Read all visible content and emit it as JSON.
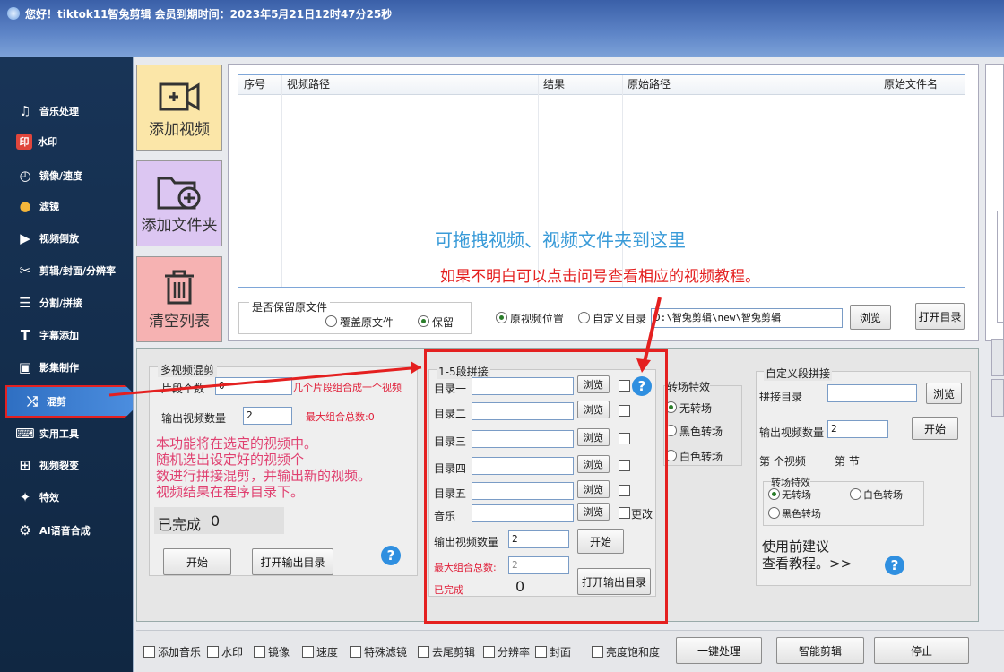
{
  "title": "您好！tiktok11智兔剪辑  会员到期时间：2023年5月21日12时47分25秒",
  "sidebar": {
    "items": [
      {
        "label": "音乐处理",
        "icon": "music-note-icon",
        "glyph": "♫"
      },
      {
        "label": "水印",
        "icon": "watermark-icon",
        "glyph": "印"
      },
      {
        "label": "镜像/速度",
        "icon": "speed-gauge-icon",
        "glyph": "◴"
      },
      {
        "label": "滤镜",
        "icon": "filter-icon",
        "glyph": "●"
      },
      {
        "label": "视频倒放",
        "icon": "video-reverse-icon",
        "glyph": "▶"
      },
      {
        "label": "剪辑/封面/分辨率",
        "icon": "scissors-icon",
        "glyph": "✂"
      },
      {
        "label": "分割/拼接",
        "icon": "split-join-icon",
        "glyph": "☰"
      },
      {
        "label": "字幕添加",
        "icon": "subtitle-icon",
        "glyph": "T"
      },
      {
        "label": "影集制作",
        "icon": "album-icon",
        "glyph": "▣"
      },
      {
        "label": "混剪",
        "icon": "shuffle-icon",
        "glyph": "⤮"
      },
      {
        "label": "实用工具",
        "icon": "tools-icon",
        "glyph": "⌨"
      },
      {
        "label": "视频裂变",
        "icon": "video-split-icon",
        "glyph": "⊞"
      },
      {
        "label": "特效",
        "icon": "sparkle-icon",
        "glyph": "✦"
      },
      {
        "label": "AI语音合成",
        "icon": "ai-voice-icon",
        "glyph": "⚙"
      }
    ]
  },
  "actions": {
    "add_video": "添加视频",
    "add_folder": "添加文件夹",
    "clear_list": "清空列表"
  },
  "table": {
    "columns": [
      "序号",
      "视频路径",
      "结果",
      "原始路径",
      "原始文件名"
    ],
    "drop_hint": "可拖拽视频、视频文件夹到这里",
    "help_hint": "如果不明白可以点击问号查看相应的视频教程。"
  },
  "output": {
    "keep_label": "是否保留原文件",
    "overwrite": "覆盖原文件",
    "keep": "保留",
    "orig_location": "原视频位置",
    "custom_dir": "自定义目录",
    "dir_path": "D:\\智兔剪辑\\new\\智兔剪辑",
    "browse": "浏览",
    "open_dir": "打开目录"
  },
  "multi_mix": {
    "title": "多视频混剪",
    "segments_label": "片段个数",
    "segments_value": "0",
    "segments_hint": "几个片段组合成一个视频",
    "output_count_label": "输出视频数量",
    "output_count_value": "2",
    "max_combo": "最大组合总数:0",
    "desc": "本功能将在选定的视频中。\n随机选出设定好的视频个\n数进行拼接混剪，并输出新的视频。\n视频结果在程序目录下。",
    "done_label": "已完成",
    "done_value": "0",
    "start": "开始",
    "open_output": "打开输出目录"
  },
  "five_seg": {
    "title": "1-5段拼接",
    "rows": [
      "目录一",
      "目录二",
      "目录三",
      "目录四",
      "目录五",
      "音乐"
    ],
    "browse": "浏览",
    "change": "更改",
    "output_count_label": "输出视频数量",
    "output_count_value": "2",
    "max_combo_label": "最大组合总数:",
    "max_combo_value": "2",
    "done_label": "已完成",
    "done_value": "0",
    "start": "开始",
    "open_output": "打开输出目录"
  },
  "transition": {
    "title": "转场特效",
    "options": [
      "无转场",
      "黑色转场",
      "白色转场"
    ]
  },
  "custom_seg": {
    "title": "自定义段拼接",
    "dir_label": "拼接目录",
    "browse": "浏览",
    "output_count_label": "输出视频数量",
    "output_count_value": "2",
    "start": "开始",
    "nth_video": "第 个视频",
    "nth_section": "第 节",
    "trans_title": "转场特效",
    "opt_none": "无转场",
    "opt_white": "白色转场",
    "opt_black": "黑色转场",
    "advice": "使用前建议\n查看教程。>>"
  },
  "bottom": {
    "checks": [
      "添加音乐",
      "水印",
      "镜像",
      "速度",
      "特殊滤镜",
      "去尾剪辑",
      "分辨率",
      "封面",
      "亮度饱和度"
    ],
    "one_click": "一键处理",
    "smart_cut": "智能剪辑",
    "stop": "停止"
  },
  "colors": {
    "accent": "#2f8fe0",
    "annotation_red": "#e42020",
    "hint_blue": "#3a9bd8"
  }
}
